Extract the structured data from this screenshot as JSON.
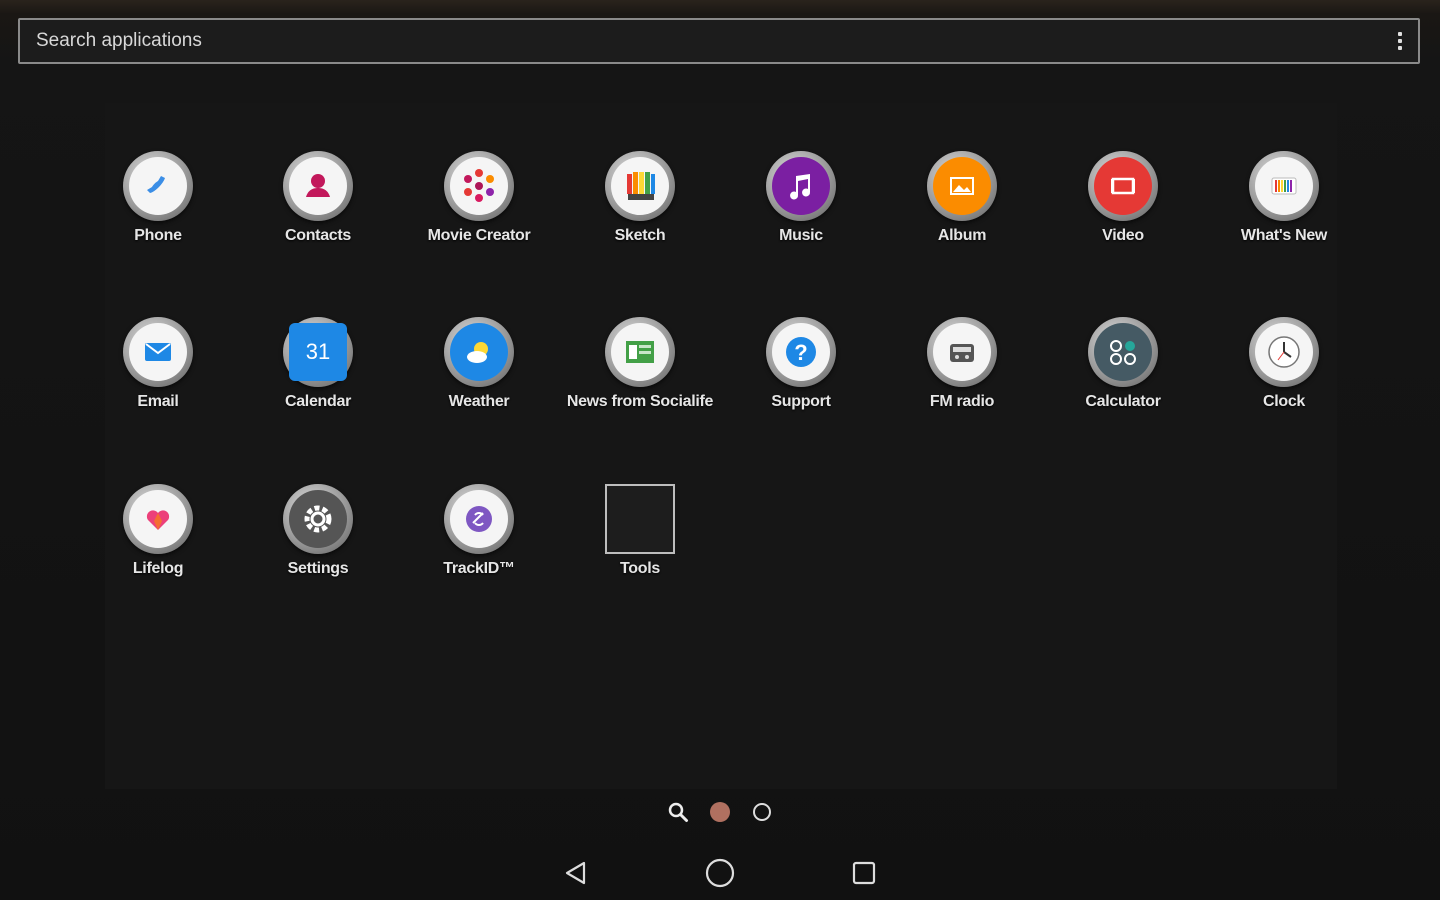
{
  "search": {
    "placeholder": "Search applications"
  },
  "apps": [
    {
      "label": "Phone",
      "icon": "phone-icon",
      "color": "#3b8ee6"
    },
    {
      "label": "Contacts",
      "icon": "contacts-icon",
      "color": "#c2185b"
    },
    {
      "label": "Movie Creator",
      "icon": "movie-creator-icon",
      "color": "#e53935"
    },
    {
      "label": "Sketch",
      "icon": "sketch-icon",
      "color": "#fbc02d"
    },
    {
      "label": "Music",
      "icon": "music-icon",
      "color": "#7b1fa2"
    },
    {
      "label": "Album",
      "icon": "album-icon",
      "color": "#fb8c00"
    },
    {
      "label": "Video",
      "icon": "video-icon",
      "color": "#e53935"
    },
    {
      "label": "What's New",
      "icon": "whats-new-icon",
      "color": "#eeeeee"
    },
    {
      "label": "Email",
      "icon": "email-icon",
      "color": "#1e88e5"
    },
    {
      "label": "Calendar",
      "icon": "calendar-icon",
      "color": "#1e88e5"
    },
    {
      "label": "Weather",
      "icon": "weather-icon",
      "color": "#1e88e5"
    },
    {
      "label": "News from Socialife",
      "icon": "news-icon",
      "color": "#43a047"
    },
    {
      "label": "Support",
      "icon": "support-icon",
      "color": "#1e88e5"
    },
    {
      "label": "FM radio",
      "icon": "fm-radio-icon",
      "color": "#eeeeee"
    },
    {
      "label": "Calculator",
      "icon": "calculator-icon",
      "color": "#455a64"
    },
    {
      "label": "Clock",
      "icon": "clock-icon",
      "color": "#eeeeee"
    },
    {
      "label": "Lifelog",
      "icon": "lifelog-icon",
      "color": "#ec407a"
    },
    {
      "label": "Settings",
      "icon": "settings-icon",
      "color": "#555555"
    },
    {
      "label": "TrackID™",
      "icon": "trackid-icon",
      "color": "#7e57c2"
    },
    {
      "label": "Tools",
      "icon": "folder-icon",
      "color": "#1d1d1d"
    }
  ],
  "calendar_day": "31",
  "pager": {
    "pages": 2,
    "current": 1,
    "accent": "#b07060"
  }
}
